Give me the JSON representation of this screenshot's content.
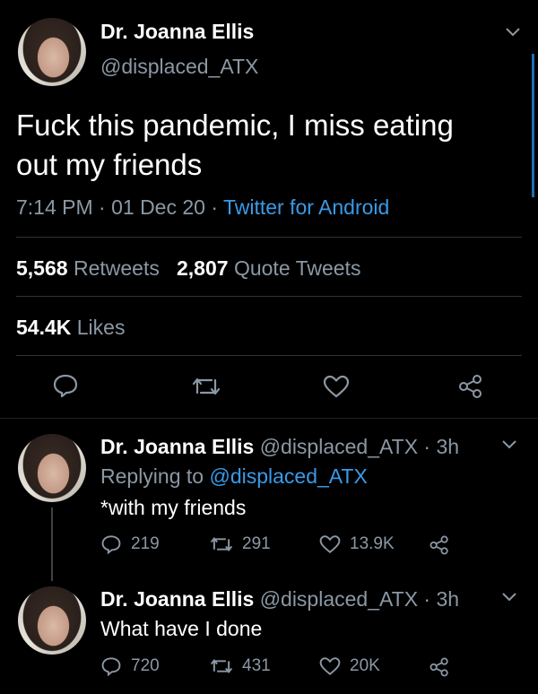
{
  "main_tweet": {
    "author_name": "Dr. Joanna Ellis",
    "author_handle": "@displaced_ATX",
    "text_line1": "Fuck this pandemic, I miss eating",
    "text_line2": "out my friends",
    "time": "7:14 PM · 01 Dec 20 · ",
    "source": "Twitter for Android",
    "retweets_count": "5,568",
    "retweets_label": "Retweets",
    "quotes_count": "2,807",
    "quotes_label": "Quote Tweets",
    "likes_count": "54.4K",
    "likes_label": "Likes"
  },
  "replies": [
    {
      "author_name": "Dr. Joanna Ellis",
      "handle_time": "@displaced_ATX · 3h",
      "replying_prefix": "Replying to ",
      "replying_handle": "@displaced_ATX",
      "text": "*with my friends",
      "reply_count": "219",
      "retweet_count": "291",
      "like_count": "13.9K"
    },
    {
      "author_name": "Dr. Joanna Ellis",
      "handle_time": "@displaced_ATX · 3h",
      "text": "What have I done",
      "reply_count": "720",
      "retweet_count": "431",
      "like_count": "20K"
    }
  ],
  "colors": {
    "accent": "#3a9ae8",
    "muted": "#8b98a5",
    "divider": "#2f3336"
  }
}
